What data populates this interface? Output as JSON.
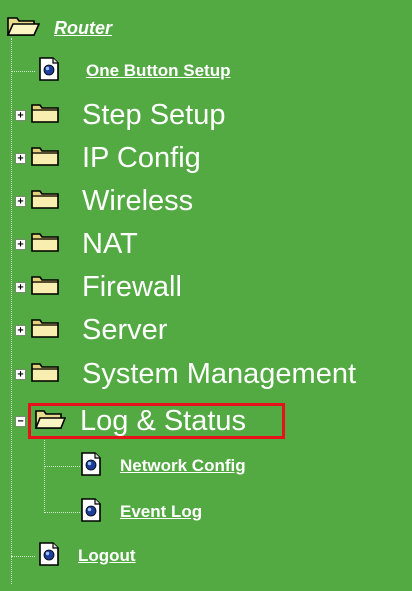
{
  "tree": {
    "root_label": "Router",
    "items": [
      {
        "label": "One Button Setup",
        "type": "page"
      },
      {
        "label": "Step Setup",
        "type": "folder"
      },
      {
        "label": "IP Config",
        "type": "folder"
      },
      {
        "label": "Wireless",
        "type": "folder"
      },
      {
        "label": "NAT",
        "type": "folder"
      },
      {
        "label": "Firewall",
        "type": "folder"
      },
      {
        "label": "Server",
        "type": "folder"
      },
      {
        "label": "System Management",
        "type": "folder"
      },
      {
        "label": "Log & Status",
        "type": "folder-open"
      },
      {
        "label": "Network Config",
        "type": "page"
      },
      {
        "label": "Event Log",
        "type": "page"
      },
      {
        "label": "Logout",
        "type": "page"
      }
    ],
    "highlight_color": "#e8101a",
    "background_color": "#53a942"
  }
}
